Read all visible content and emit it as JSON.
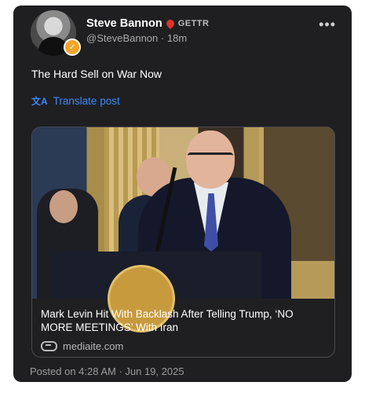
{
  "author": {
    "display_name": "Steve Bannon",
    "platform_label": "GETTR",
    "handle": "@SteveBannon",
    "separator": "·",
    "relative_time": "18m"
  },
  "menu_icon": "more-horizontal-icon",
  "post": {
    "text": "The Hard Sell on War Now",
    "translate_label": "Translate post",
    "translate_icon": "translate-icon"
  },
  "link_preview": {
    "title": "Mark Levin Hit With Backlash After Telling Trump, ‘NO MORE MEETINGS’ With Iran",
    "domain": "mediaite.com",
    "link_icon": "link-icon"
  },
  "footer": {
    "posted_on": "Posted on 4:28 AM · Jun 19, 2025"
  },
  "colors": {
    "card_background": "#1f1f21",
    "accent_blue": "#3d8af7",
    "gettr_red": "#e0332a",
    "badge_orange": "#f3a52b"
  }
}
